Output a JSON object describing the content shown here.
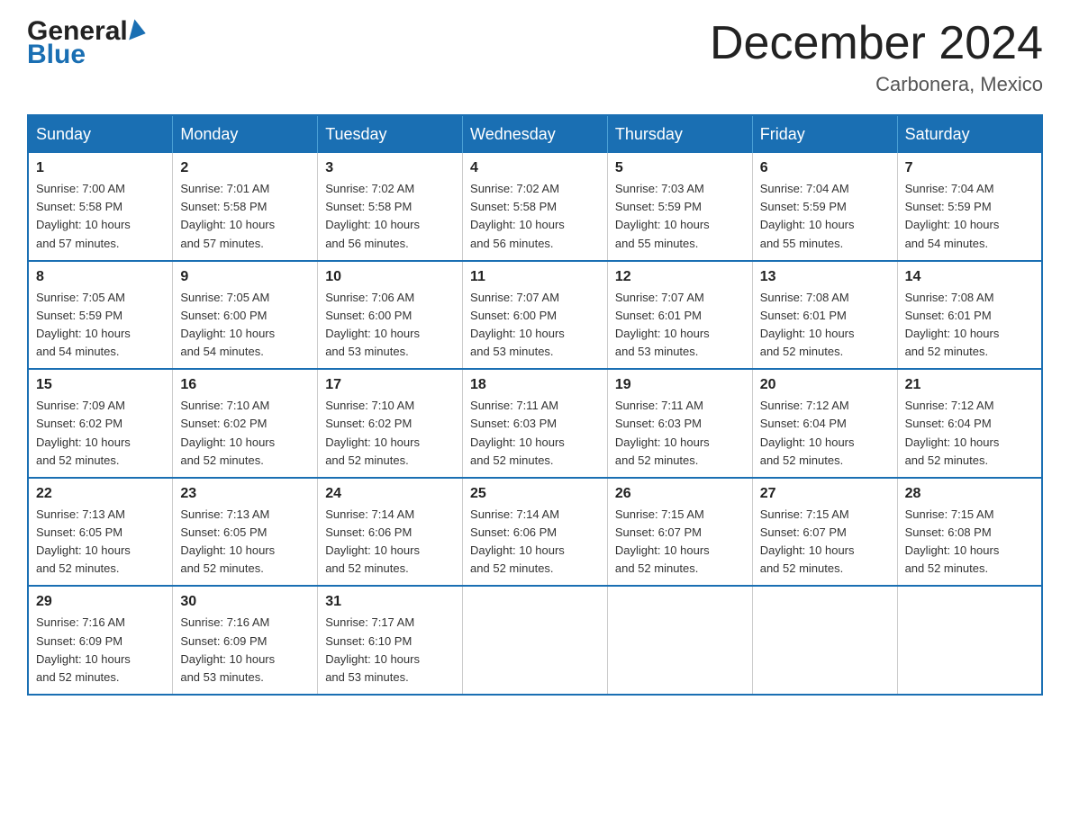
{
  "header": {
    "logo_general": "General",
    "logo_blue": "Blue",
    "month_title": "December 2024",
    "location": "Carbonera, Mexico"
  },
  "days_of_week": [
    "Sunday",
    "Monday",
    "Tuesday",
    "Wednesday",
    "Thursday",
    "Friday",
    "Saturday"
  ],
  "weeks": [
    [
      {
        "day": "1",
        "sunrise": "7:00 AM",
        "sunset": "5:58 PM",
        "daylight": "10 hours and 57 minutes."
      },
      {
        "day": "2",
        "sunrise": "7:01 AM",
        "sunset": "5:58 PM",
        "daylight": "10 hours and 57 minutes."
      },
      {
        "day": "3",
        "sunrise": "7:02 AM",
        "sunset": "5:58 PM",
        "daylight": "10 hours and 56 minutes."
      },
      {
        "day": "4",
        "sunrise": "7:02 AM",
        "sunset": "5:58 PM",
        "daylight": "10 hours and 56 minutes."
      },
      {
        "day": "5",
        "sunrise": "7:03 AM",
        "sunset": "5:59 PM",
        "daylight": "10 hours and 55 minutes."
      },
      {
        "day": "6",
        "sunrise": "7:04 AM",
        "sunset": "5:59 PM",
        "daylight": "10 hours and 55 minutes."
      },
      {
        "day": "7",
        "sunrise": "7:04 AM",
        "sunset": "5:59 PM",
        "daylight": "10 hours and 54 minutes."
      }
    ],
    [
      {
        "day": "8",
        "sunrise": "7:05 AM",
        "sunset": "5:59 PM",
        "daylight": "10 hours and 54 minutes."
      },
      {
        "day": "9",
        "sunrise": "7:05 AM",
        "sunset": "6:00 PM",
        "daylight": "10 hours and 54 minutes."
      },
      {
        "day": "10",
        "sunrise": "7:06 AM",
        "sunset": "6:00 PM",
        "daylight": "10 hours and 53 minutes."
      },
      {
        "day": "11",
        "sunrise": "7:07 AM",
        "sunset": "6:00 PM",
        "daylight": "10 hours and 53 minutes."
      },
      {
        "day": "12",
        "sunrise": "7:07 AM",
        "sunset": "6:01 PM",
        "daylight": "10 hours and 53 minutes."
      },
      {
        "day": "13",
        "sunrise": "7:08 AM",
        "sunset": "6:01 PM",
        "daylight": "10 hours and 52 minutes."
      },
      {
        "day": "14",
        "sunrise": "7:08 AM",
        "sunset": "6:01 PM",
        "daylight": "10 hours and 52 minutes."
      }
    ],
    [
      {
        "day": "15",
        "sunrise": "7:09 AM",
        "sunset": "6:02 PM",
        "daylight": "10 hours and 52 minutes."
      },
      {
        "day": "16",
        "sunrise": "7:10 AM",
        "sunset": "6:02 PM",
        "daylight": "10 hours and 52 minutes."
      },
      {
        "day": "17",
        "sunrise": "7:10 AM",
        "sunset": "6:02 PM",
        "daylight": "10 hours and 52 minutes."
      },
      {
        "day": "18",
        "sunrise": "7:11 AM",
        "sunset": "6:03 PM",
        "daylight": "10 hours and 52 minutes."
      },
      {
        "day": "19",
        "sunrise": "7:11 AM",
        "sunset": "6:03 PM",
        "daylight": "10 hours and 52 minutes."
      },
      {
        "day": "20",
        "sunrise": "7:12 AM",
        "sunset": "6:04 PM",
        "daylight": "10 hours and 52 minutes."
      },
      {
        "day": "21",
        "sunrise": "7:12 AM",
        "sunset": "6:04 PM",
        "daylight": "10 hours and 52 minutes."
      }
    ],
    [
      {
        "day": "22",
        "sunrise": "7:13 AM",
        "sunset": "6:05 PM",
        "daylight": "10 hours and 52 minutes."
      },
      {
        "day": "23",
        "sunrise": "7:13 AM",
        "sunset": "6:05 PM",
        "daylight": "10 hours and 52 minutes."
      },
      {
        "day": "24",
        "sunrise": "7:14 AM",
        "sunset": "6:06 PM",
        "daylight": "10 hours and 52 minutes."
      },
      {
        "day": "25",
        "sunrise": "7:14 AM",
        "sunset": "6:06 PM",
        "daylight": "10 hours and 52 minutes."
      },
      {
        "day": "26",
        "sunrise": "7:15 AM",
        "sunset": "6:07 PM",
        "daylight": "10 hours and 52 minutes."
      },
      {
        "day": "27",
        "sunrise": "7:15 AM",
        "sunset": "6:07 PM",
        "daylight": "10 hours and 52 minutes."
      },
      {
        "day": "28",
        "sunrise": "7:15 AM",
        "sunset": "6:08 PM",
        "daylight": "10 hours and 52 minutes."
      }
    ],
    [
      {
        "day": "29",
        "sunrise": "7:16 AM",
        "sunset": "6:09 PM",
        "daylight": "10 hours and 52 minutes."
      },
      {
        "day": "30",
        "sunrise": "7:16 AM",
        "sunset": "6:09 PM",
        "daylight": "10 hours and 53 minutes."
      },
      {
        "day": "31",
        "sunrise": "7:17 AM",
        "sunset": "6:10 PM",
        "daylight": "10 hours and 53 minutes."
      },
      null,
      null,
      null,
      null
    ]
  ],
  "labels": {
    "sunrise": "Sunrise:",
    "sunset": "Sunset:",
    "daylight": "Daylight:"
  }
}
